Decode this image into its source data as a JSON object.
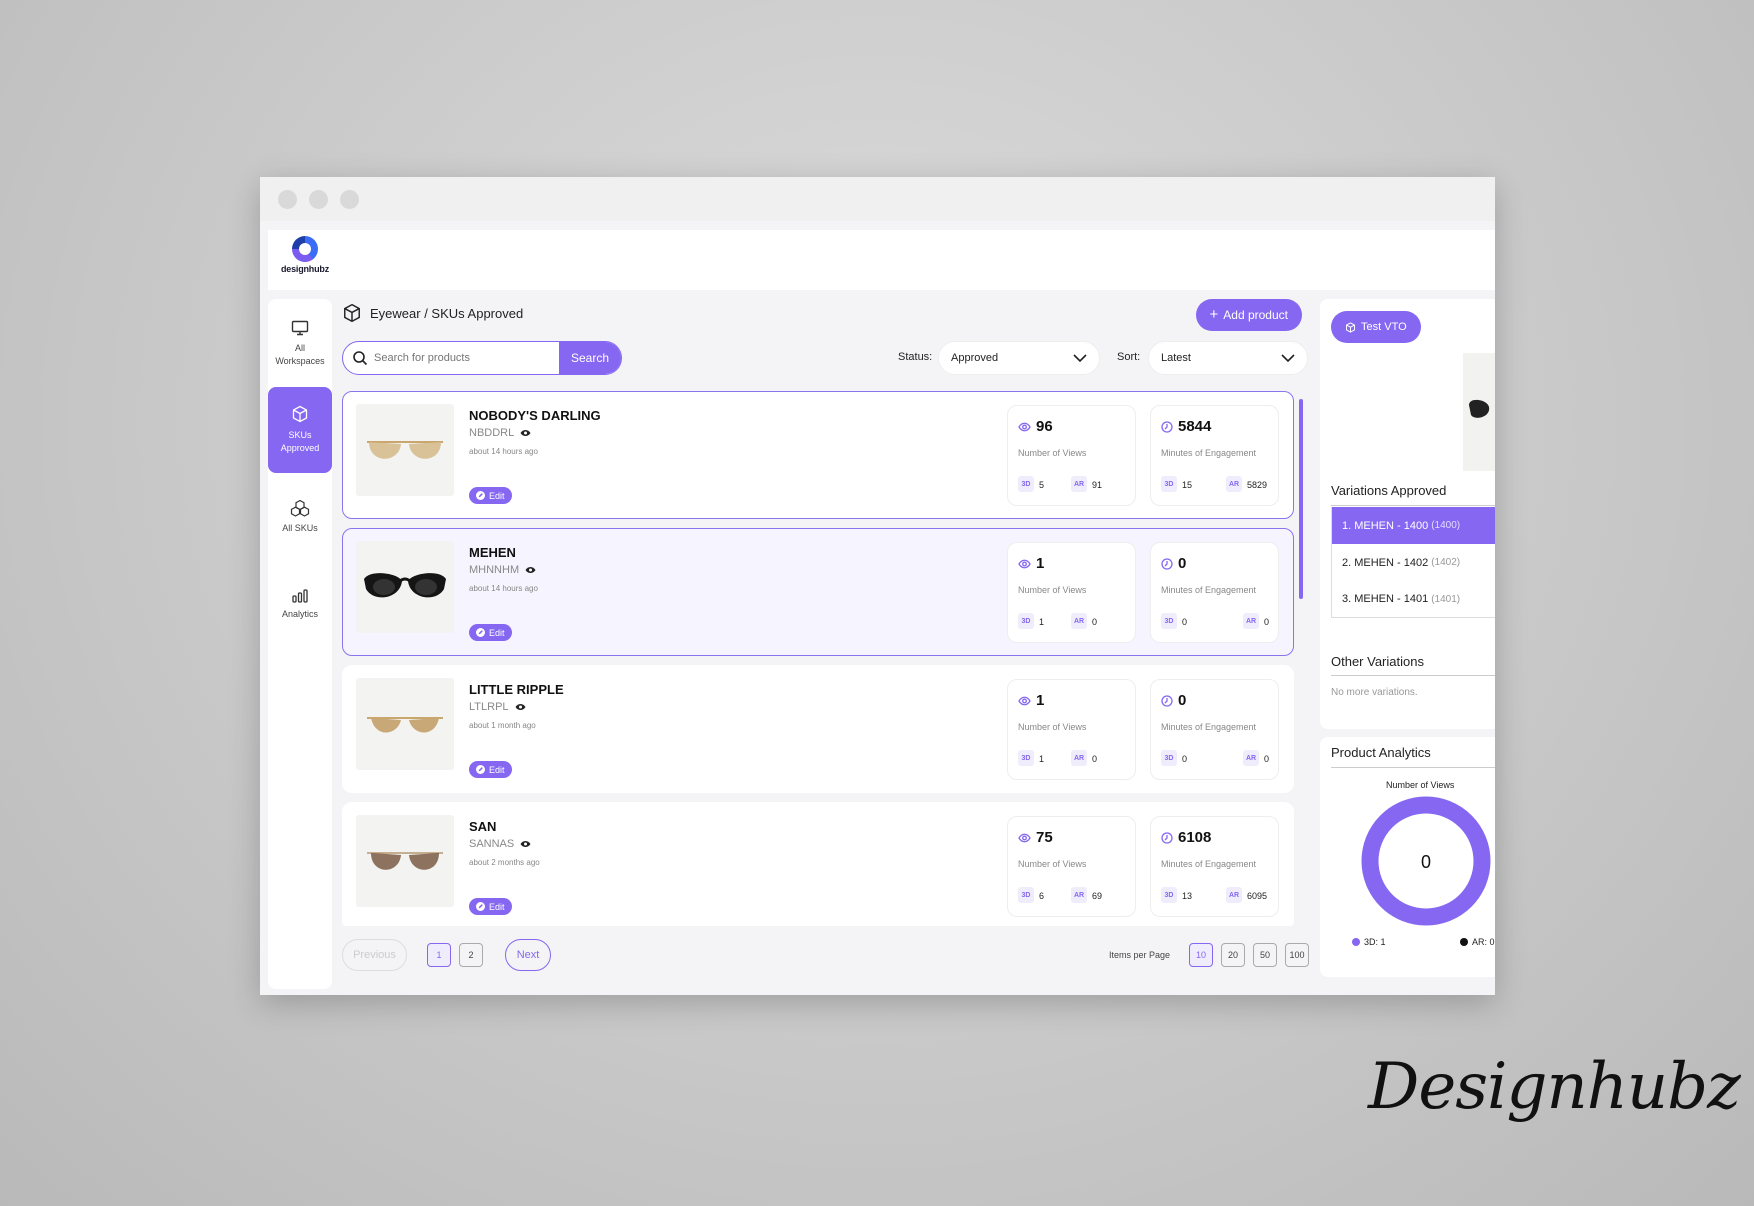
{
  "brand": {
    "logo_text": "designhubz",
    "signature": "Designhubz"
  },
  "sidebar": {
    "items": [
      {
        "label": "All Workspaces",
        "icon": "monitor-icon",
        "active": false
      },
      {
        "label": "SKUs Approved",
        "icon": "cube-icon",
        "active": true
      },
      {
        "label": "All SKUs",
        "icon": "cubes-icon",
        "active": false
      },
      {
        "label": "Analytics",
        "icon": "bar-chart-icon",
        "active": false
      }
    ]
  },
  "header": {
    "breadcrumb": "Eyewear / SKUs Approved",
    "add_button": "Add product",
    "search_placeholder": "Search for products",
    "search_button": "Search",
    "status_label": "Status:",
    "status_value": "Approved",
    "sort_label": "Sort:",
    "sort_value": "Latest"
  },
  "products": [
    {
      "name": "NOBODY'S DARLING",
      "code": "NBDDRL",
      "time": "about 14 hours ago",
      "edit": "Edit",
      "views": "96",
      "views_label": "Number of Views",
      "views_3d": "5",
      "views_ar": "91",
      "minutes": "5844",
      "minutes_label": "Minutes of Engagement",
      "min_3d": "15",
      "min_ar": "5829"
    },
    {
      "name": "MEHEN",
      "code": "MHNNHM",
      "time": "about 14 hours ago",
      "edit": "Edit",
      "views": "1",
      "views_label": "Number of Views",
      "views_3d": "1",
      "views_ar": "0",
      "minutes": "0",
      "minutes_label": "Minutes of Engagement",
      "min_3d": "0",
      "min_ar": "0"
    },
    {
      "name": "LITTLE RIPPLE",
      "code": "LTLRPL",
      "time": "about 1 month ago",
      "edit": "Edit",
      "views": "1",
      "views_label": "Number of Views",
      "views_3d": "1",
      "views_ar": "0",
      "minutes": "0",
      "minutes_label": "Minutes of Engagement",
      "min_3d": "0",
      "min_ar": "0"
    },
    {
      "name": "SAN",
      "code": "SANNAS",
      "time": "about 2 months ago",
      "edit": "Edit",
      "views": "75",
      "views_label": "Number of Views",
      "views_3d": "6",
      "views_ar": "69",
      "minutes": "6108",
      "minutes_label": "Minutes of Engagement",
      "min_3d": "13",
      "min_ar": "6095"
    }
  ],
  "chips": {
    "three_d": "3D",
    "ar": "AR"
  },
  "pagination": {
    "previous": "Previous",
    "next": "Next",
    "pages": [
      "1",
      "2"
    ],
    "items_per_page_label": "Items per Page",
    "sizes": [
      "10",
      "20",
      "50",
      "100"
    ]
  },
  "right_panel": {
    "test_vto": "Test VTO",
    "variations_title": "Variations Approved",
    "variations": [
      {
        "label": "1. MEHEN - 1400",
        "sub": "(1400)"
      },
      {
        "label": "2. MEHEN - 1402",
        "sub": "(1402)"
      },
      {
        "label": "3. MEHEN - 1401",
        "sub": "(1401)"
      }
    ],
    "other_title": "Other Variations",
    "other_empty": "No more variations.",
    "analytics_title": "Product Analytics",
    "chart_title": "Number of Views",
    "chart_center": "0",
    "legend_3d": "3D: 1",
    "legend_ar": "AR: 0"
  },
  "colors": {
    "accent": "#8567f1",
    "accent_light": "#efedfc"
  }
}
